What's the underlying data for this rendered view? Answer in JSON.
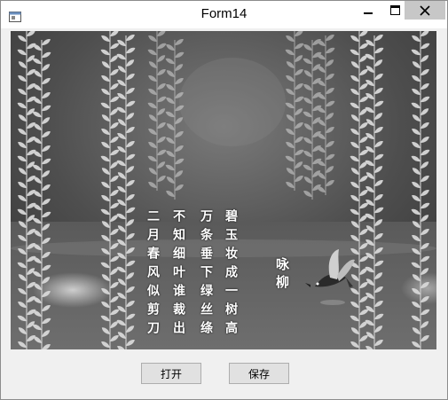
{
  "window": {
    "title": "Form14",
    "controls": {
      "minimize_icon": "minimize-icon",
      "maximize_icon": "maximize-icon",
      "close_icon": "close-icon"
    }
  },
  "picture": {
    "poem_title": "咏柳",
    "poem_lines": [
      "碧玉妆成一树高",
      "万条垂下绿丝绦",
      "不知细叶谁裁出",
      "二月春风似剪刀"
    ]
  },
  "buttons": {
    "open_label": "打开",
    "save_label": "保存"
  }
}
